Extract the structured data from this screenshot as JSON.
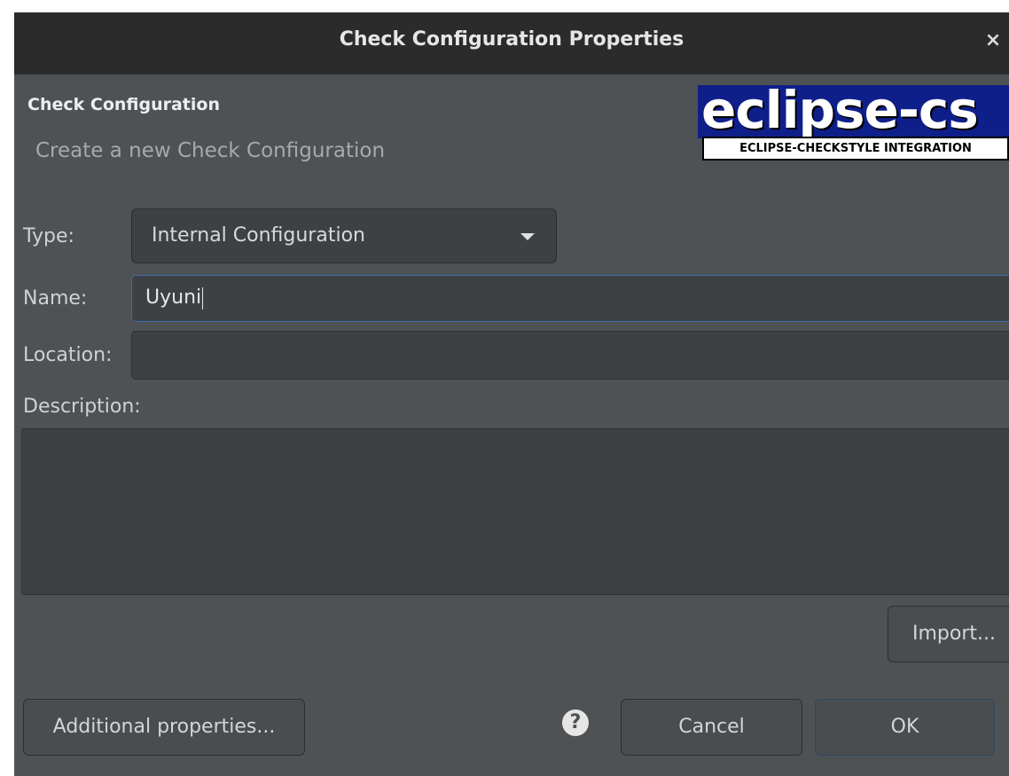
{
  "window": {
    "title": "Check Configuration Properties",
    "close_icon": "×"
  },
  "header": {
    "heading": "Check Configuration",
    "description": "Create a new Check Configuration",
    "logo": {
      "main_text": "eclipse-cs",
      "sub_text": "ECLIPSE-CHECKSTYLE INTEGRATION"
    }
  },
  "form": {
    "type": {
      "label": "Type:",
      "value": "Internal Configuration"
    },
    "name": {
      "label": "Name:",
      "value": "Uyuni"
    },
    "location": {
      "label": "Location:",
      "value": ""
    },
    "description": {
      "label": "Description:",
      "value": ""
    }
  },
  "buttons": {
    "import": "Import...",
    "additional_properties": "Additional properties...",
    "help": "?",
    "cancel": "Cancel",
    "ok": "OK"
  },
  "colors": {
    "dialog_bg": "#4f5254",
    "titlebar_bg": "#2b2b2b",
    "focus_border": "#3c6ea8",
    "logo_blue": "#0f1f8a"
  }
}
